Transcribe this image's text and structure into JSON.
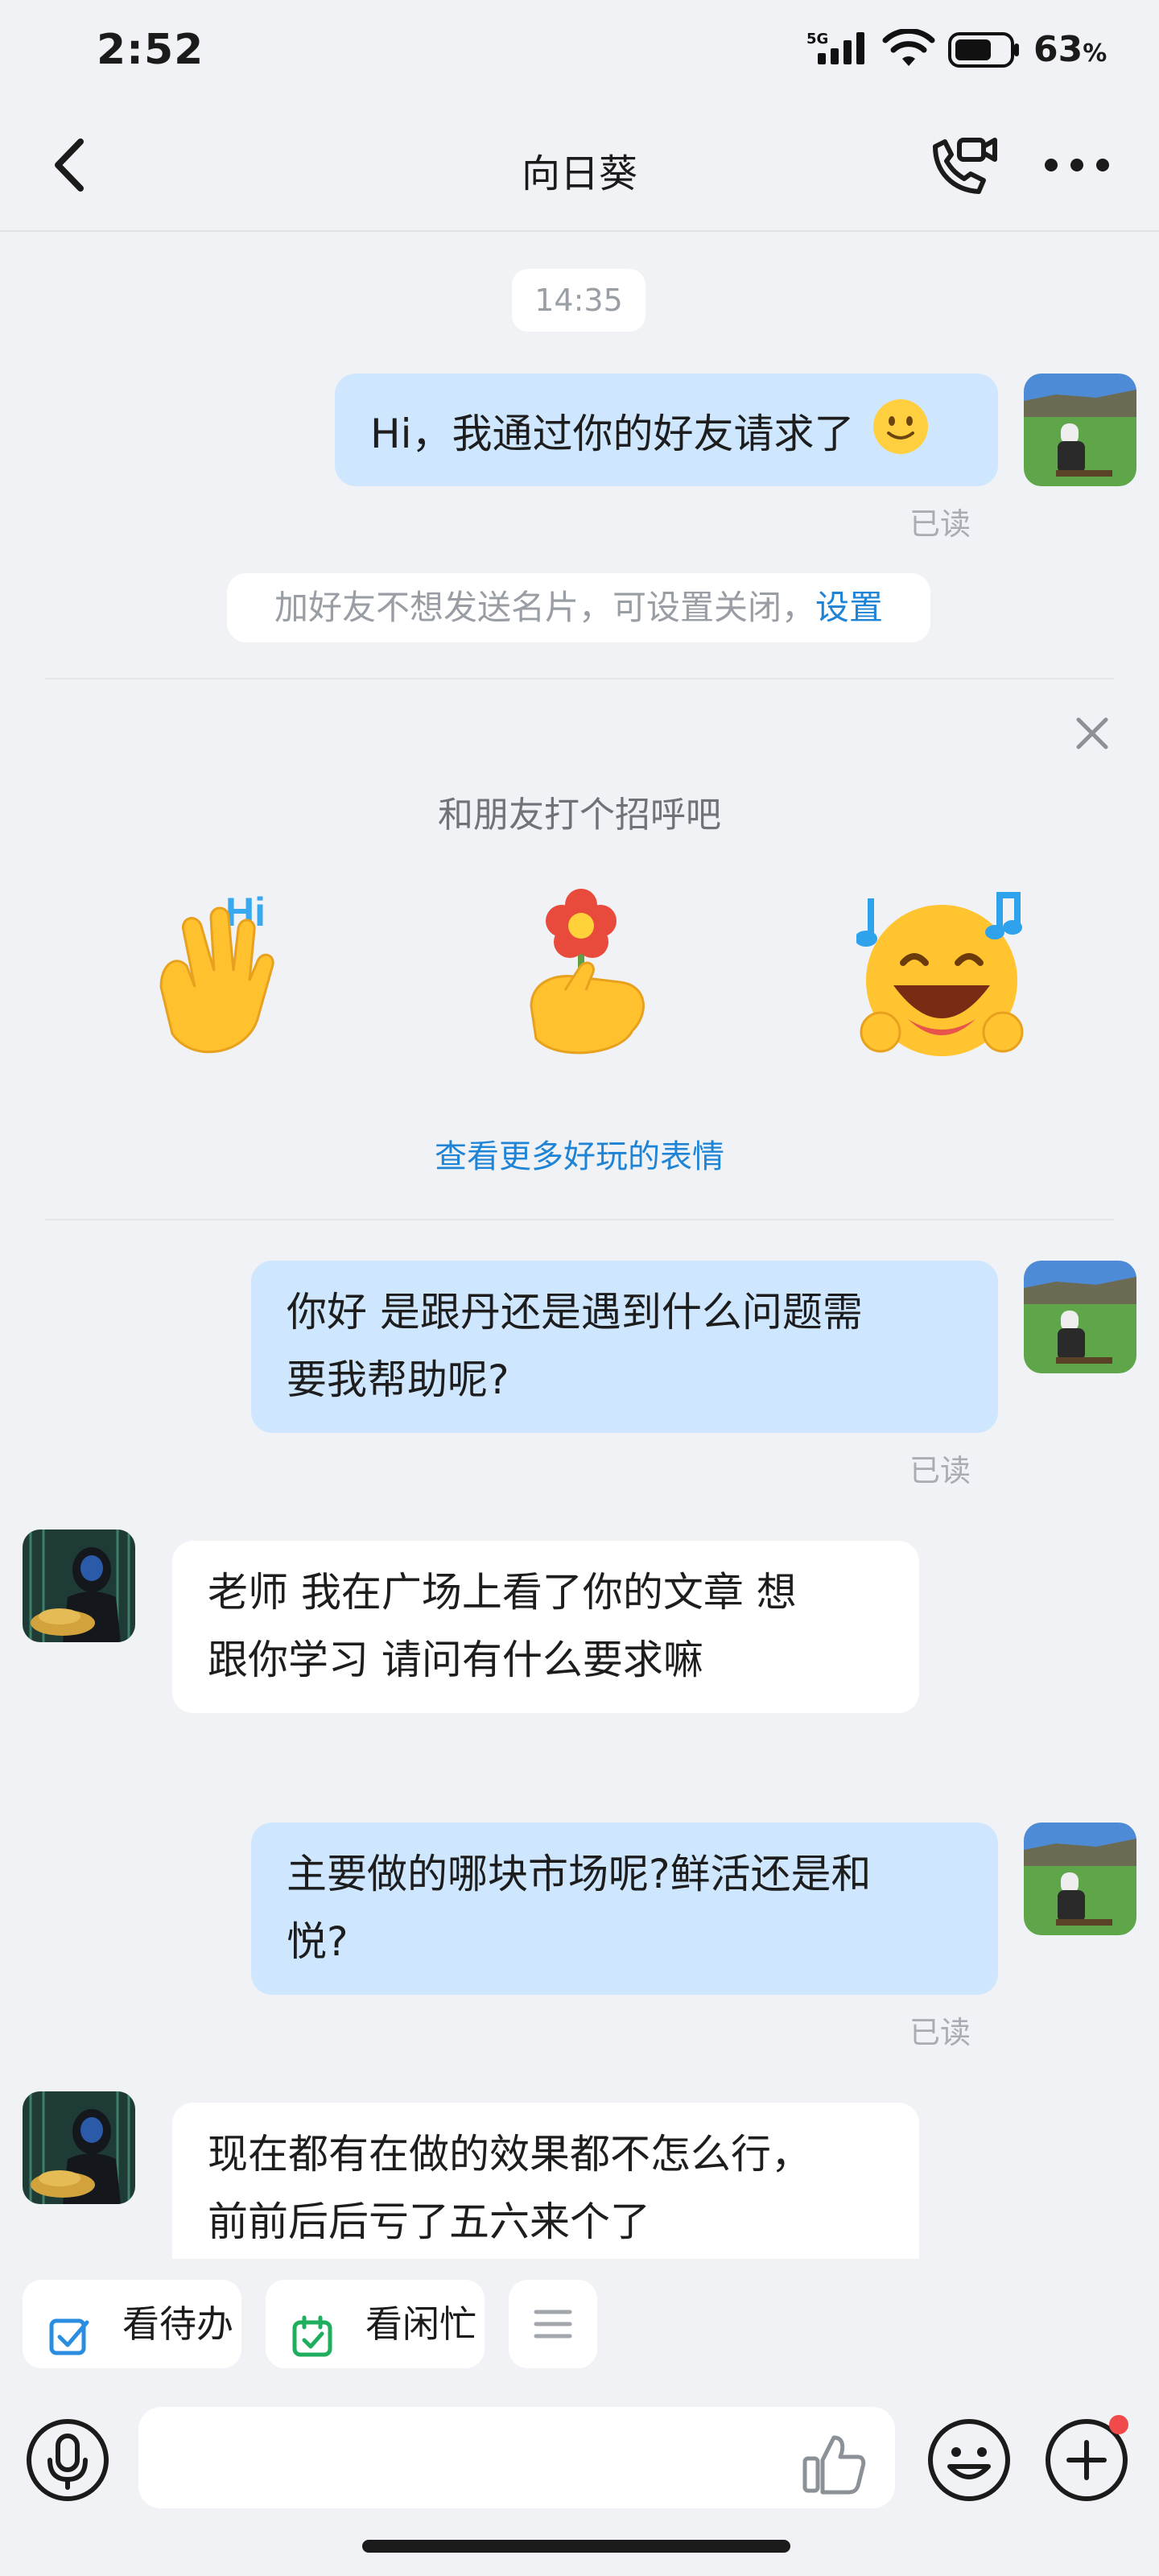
{
  "status_bar": {
    "time": "2:52",
    "network": "5G",
    "battery_number": "63",
    "battery_unit": "%"
  },
  "header": {
    "title": "向日葵",
    "back_icon": "chevron-left-icon",
    "call_icon": "phone-video-icon",
    "more_icon": "more-dots-icon"
  },
  "chat": {
    "timestamp": "14:35",
    "messages": [
      {
        "from": "me",
        "text": "Hi，我通过你的好友请求了",
        "emoji": "slightly-smiling-face",
        "status": "已读"
      },
      {
        "from": "me",
        "line1": "你好 是跟丹还是遇到什么问题需",
        "line2": "要我帮助呢?",
        "status": "已读"
      },
      {
        "from": "them",
        "line1": "老师 我在广场上看了你的文章 想",
        "line2": "跟你学习 请问有什么要求嘛"
      },
      {
        "from": "me",
        "line1": "主要做的哪块市场呢?鲜活还是和",
        "line2": "悦?",
        "status": "已读"
      },
      {
        "from": "them",
        "line1": "现在都有在做的效果都不怎么行，",
        "line2": "前前后后亏了五六来个了"
      }
    ],
    "notice": {
      "text": "加好友不想发送名片，可设置关闭，",
      "link": "设置"
    }
  },
  "greeting": {
    "title": "和朋友打个招呼吧",
    "more_link": "查看更多好玩的表情",
    "stickers": [
      "waving-hand-hi-sticker",
      "hand-holding-flower-sticker",
      "laughing-music-sticker"
    ],
    "close_icon": "close-icon"
  },
  "quick_actions": [
    {
      "label": "看待办",
      "icon": "checkbox-icon",
      "color": "#2a8de0"
    },
    {
      "label": "看闲忙",
      "icon": "calendar-check-icon",
      "color": "#1fae5e"
    },
    {
      "icon": "menu-lines-icon"
    }
  ],
  "input_bar": {
    "mic_icon": "microphone-icon",
    "like_icon": "thumbs-up-icon",
    "emoji_icon": "emoji-icon",
    "plus_icon": "plus-icon"
  },
  "colors": {
    "outgoing_bubble": "#cfe6ff",
    "link": "#1f84d6",
    "background": "#f1f2f5"
  }
}
